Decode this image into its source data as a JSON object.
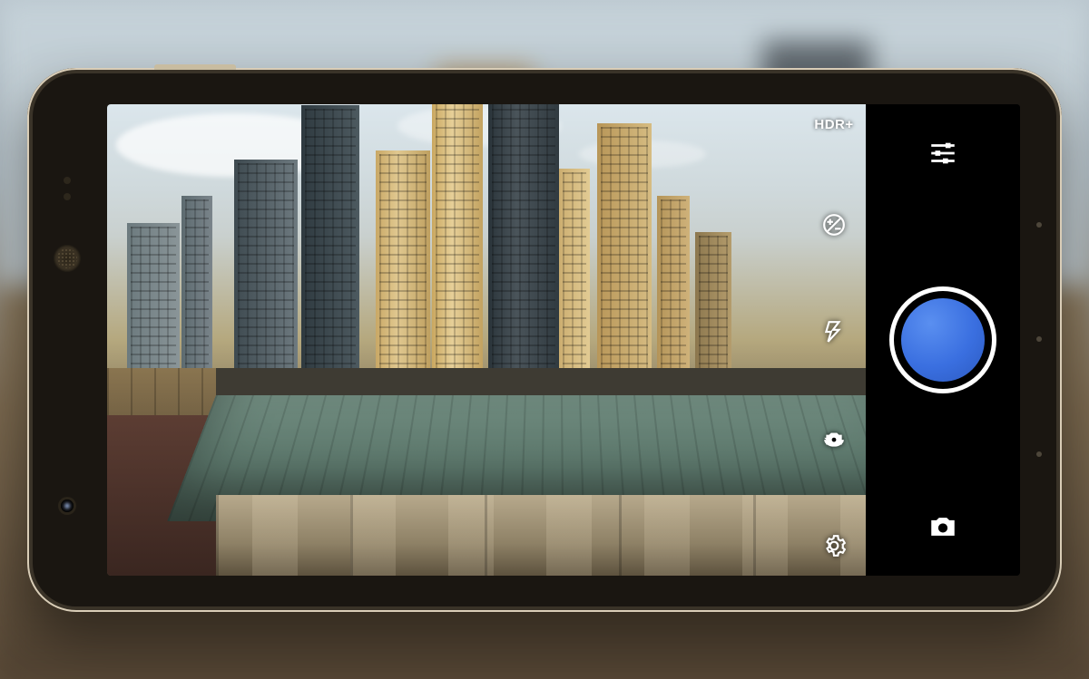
{
  "viewfinder": {
    "hdr_label": "HDR+"
  },
  "overlay_icons": {
    "exposure": "exposure-compensation-icon",
    "flash": "flash-icon",
    "switch_camera": "switch-camera-icon",
    "settings": "settings-gear-icon"
  },
  "controls": {
    "options": "options-sliders-icon",
    "shutter": "shutter-button",
    "mode": "camera-mode-icon"
  },
  "colors": {
    "shutter_fill": "#3a6fe0",
    "shutter_ring": "#ffffff",
    "control_bg": "#000000"
  }
}
